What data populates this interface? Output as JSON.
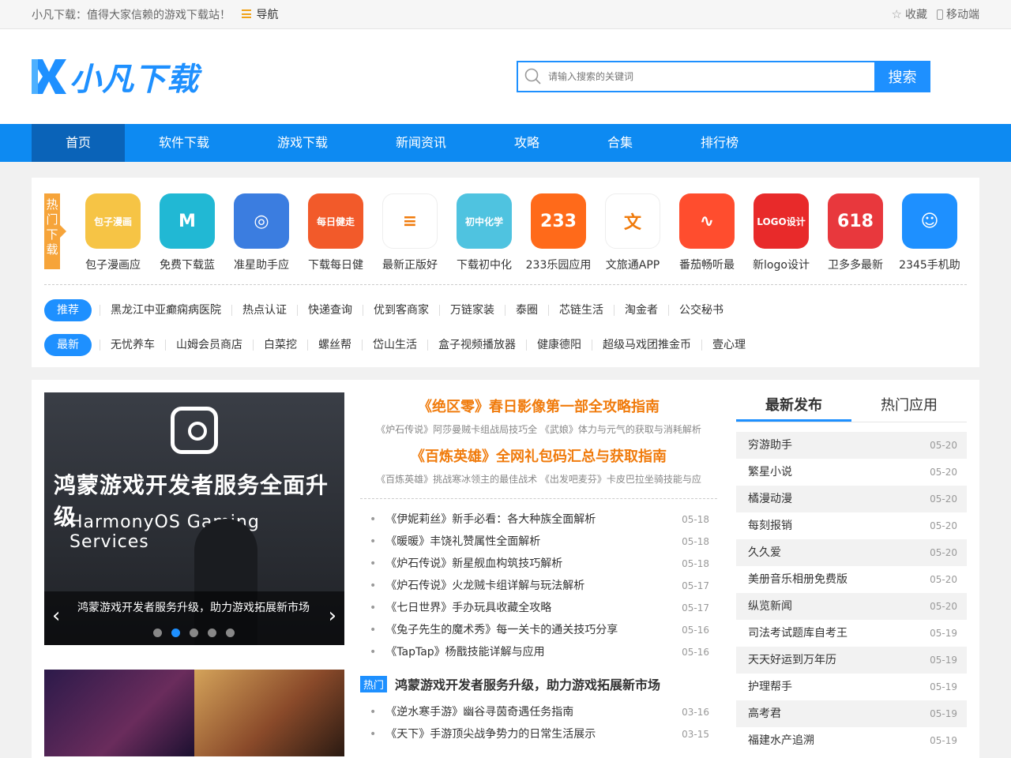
{
  "topbar": {
    "slogan": "小凡下载：值得大家信赖的游戏下载站！",
    "nav_link": "导航",
    "favorite": "收藏",
    "mobile": "移动端"
  },
  "header": {
    "logo_text": "小凡下载",
    "search_placeholder": "请输入搜索的关键词",
    "search_button": "搜索"
  },
  "nav": {
    "items": [
      {
        "label": "首页"
      },
      {
        "label": "软件下载"
      },
      {
        "label": "游戏下载"
      },
      {
        "label": "新闻资讯"
      },
      {
        "label": "攻略"
      },
      {
        "label": "合集"
      },
      {
        "label": "排行榜"
      }
    ]
  },
  "hot": {
    "tag": "热门下载",
    "tag_chars": [
      "热",
      "门",
      "下",
      "载"
    ],
    "apps": [
      {
        "name": "包子漫画应",
        "icon": "包子漫画",
        "color": "#f6c445"
      },
      {
        "name": "免费下载蓝",
        "icon": "M",
        "color": "#21b8d4"
      },
      {
        "name": "准星助手应",
        "icon": "◎",
        "color": "#3b7de0"
      },
      {
        "name": "下载每日健",
        "icon": "每日健走",
        "color": "#f25a2a"
      },
      {
        "name": "最新正版好",
        "icon": "≡",
        "color": "#ffffff"
      },
      {
        "name": "下载初中化",
        "icon": "初中化学",
        "color": "#4fc3e0"
      },
      {
        "name": "233乐园应用",
        "icon": "233",
        "color": "#ff6a1a"
      },
      {
        "name": "文旅通APP",
        "icon": "文",
        "color": "#ffffff"
      },
      {
        "name": "番茄畅听最",
        "icon": "∿",
        "color": "#ff4d2e"
      },
      {
        "name": "新logo设计",
        "icon": "LOGO设计",
        "color": "#e82a2a"
      },
      {
        "name": "卫多多最新",
        "icon": "618",
        "color": "#e8383d"
      },
      {
        "name": "2345手机助",
        "icon": "☺",
        "color": "#1e90ff"
      }
    ]
  },
  "tags": {
    "recommend_label": "推荐",
    "recommend": [
      "黑龙江中亚癫痫病医院",
      "热点认证",
      "快递查询",
      "优到客商家",
      "万链家装",
      "泰圈",
      "芯链生活",
      "淘金者",
      "公交秘书"
    ],
    "latest_label": "最新",
    "latest": [
      "无忧养车",
      "山姆会员商店",
      "白菜挖",
      "螺丝帮",
      "岱山生活",
      "盒子视频播放器",
      "健康德阳",
      "超级马戏团推金币",
      "壹心理"
    ]
  },
  "slider": {
    "headline": "鸿蒙游戏开发者服务全面升级",
    "sub": "HarmonyOS Gaming Services",
    "caption": "鸿蒙游戏开发者服务升级，助力游戏拓展新市场",
    "prev": "‹",
    "next": "›",
    "active_dot": 1,
    "dot_count": 5
  },
  "middle": {
    "headlines": [
      {
        "title": "《绝区零》春日影像第一部全攻略指南",
        "sub": "《炉石传说》阿莎曼贼卡组战局技巧全 《武娘》体力与元气的获取与消耗解析"
      },
      {
        "title": "《百炼英雄》全网礼包码汇总与获取指南",
        "sub": "《百炼英雄》挑战寒冰领主的最佳战术 《出发吧麦芬》卡皮巴拉坐骑技能与应"
      }
    ],
    "news": [
      {
        "title": "《伊妮莉丝》新手必看：各大种族全面解析",
        "date": "05-18"
      },
      {
        "title": "《暖暖》丰饶礼赞属性全面解析",
        "date": "05-18"
      },
      {
        "title": "《炉石传说》新星舰血构筑技巧解析",
        "date": "05-18"
      },
      {
        "title": "《炉石传说》火龙贼卡组详解与玩法解析",
        "date": "05-17"
      },
      {
        "title": "《七日世界》手办玩具收藏全攻略",
        "date": "05-17"
      },
      {
        "title": "《兔子先生的魔术秀》每一关卡的通关技巧分享",
        "date": "05-16"
      },
      {
        "title": "《TapTap》杨戬技能详解与应用",
        "date": "05-16"
      }
    ],
    "hot_badge": "热门",
    "hot_title": "鸿蒙游戏开发者服务升级，助力游戏拓展新市场",
    "hot_news": [
      {
        "title": "《逆水寒手游》幽谷寻茵奇遇任务指南",
        "date": "03-16"
      },
      {
        "title": "《天下》手游顶尖战争势力的日常生活展示",
        "date": "03-15"
      }
    ]
  },
  "right": {
    "tab_latest": "最新发布",
    "tab_hot": "热门应用",
    "items": [
      {
        "name": "穷游助手",
        "date": "05-20"
      },
      {
        "name": "繁星小说",
        "date": "05-20"
      },
      {
        "name": "橘漫动漫",
        "date": "05-20"
      },
      {
        "name": "每刻报销",
        "date": "05-20"
      },
      {
        "name": "久久爱",
        "date": "05-20"
      },
      {
        "name": "美册音乐相册免费版",
        "date": "05-20"
      },
      {
        "name": "纵览新闻",
        "date": "05-20"
      },
      {
        "name": "司法考试题库自考王",
        "date": "05-19"
      },
      {
        "name": "天天好运到万年历",
        "date": "05-19"
      },
      {
        "name": "护理帮手",
        "date": "05-19"
      },
      {
        "name": "高考君",
        "date": "05-19"
      },
      {
        "name": "福建水产追溯",
        "date": "05-19"
      }
    ]
  }
}
